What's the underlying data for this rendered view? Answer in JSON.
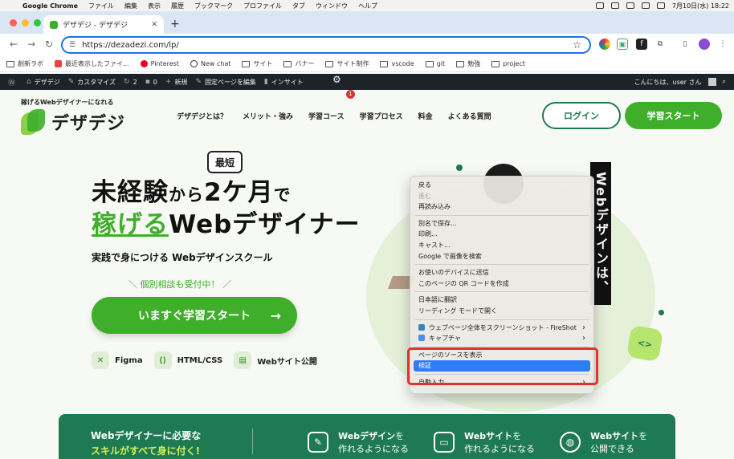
{
  "menubar": {
    "app": "Google Chrome",
    "items": [
      "ファイル",
      "編集",
      "表示",
      "履歴",
      "ブックマーク",
      "プロファイル",
      "タブ",
      "ウィンドウ",
      "ヘルプ"
    ],
    "clock": "7月10日(水) 18:22"
  },
  "browser": {
    "tab_title": "デザデジ - デザデジ",
    "url": "https://dezadezi.com/lp/",
    "bookmarks": [
      "創新ラボ",
      "最近表示したファイ...",
      "Pinterest",
      "New chat",
      "サイト",
      "バナー",
      "サイト制作",
      "vscode",
      "git",
      "勉強",
      "project"
    ]
  },
  "wpbar": {
    "site_name": "デザデジ",
    "customize": "カスタマイズ",
    "updates": "2",
    "comments": "0",
    "new": "新規",
    "edit_page": "固定ページを編集",
    "insight": "インサイト",
    "notif_count": "1",
    "greeting": "こんにちは、user さん"
  },
  "site": {
    "tagline": "稼げるWebデザイナーになれる",
    "logo": "デザデジ",
    "nav": [
      "デザデジとは？",
      "メリット・強み",
      "学習コース",
      "学習プロセス",
      "料金",
      "よくある質問"
    ],
    "login": "ログイン",
    "start": "学習スタート"
  },
  "hero": {
    "badge": "最短",
    "line1_a": "未経験",
    "line1_b": "から",
    "line1_c": "2ケ月",
    "line1_d": "で",
    "line2_green": "稼げる",
    "line2_rest": "Webデザイナー",
    "subline": "実践で身につける Webデザインスクール",
    "consult": "＼ 個別相談も受付中！ ／",
    "cta": "いますぐ学習スタート",
    "cta_arrow": "→",
    "skills": [
      "Figma",
      "HTML/CSS",
      "Webサイト公開"
    ],
    "vertical_banner": "Webデザインは、",
    "code_badge": "<>"
  },
  "feature": {
    "title_line1": "Webデザイナーに必要な",
    "title_line2": "スキルがすべて身に付く!",
    "items": [
      {
        "bold": "Webデザイン",
        "rest": "を",
        "line2": "作れるようになる"
      },
      {
        "bold": "Webサイト",
        "rest": "を",
        "line2": "作れるようになる"
      },
      {
        "bold": "Webサイト",
        "rest": "を",
        "line2": "公開できる"
      }
    ]
  },
  "context_menu": {
    "back": "戻る",
    "forward": "進む",
    "reload": "再読み込み",
    "save_as": "別名で保存...",
    "print": "印刷...",
    "cast": "キャスト...",
    "google_lens": "Google で画像を検索",
    "send_device": "お使いのデバイスに送信",
    "qr": "このページの QR コードを作成",
    "translate": "日本語に翻訳",
    "reading_mode": "リーディング モードで開く",
    "fireshot": "ウェブページ全体をスクリーンショット - FireShot",
    "capture": "キャプチャ",
    "view_source": "ページのソースを表示",
    "inspect": "検証",
    "autofill": "自動入力"
  }
}
